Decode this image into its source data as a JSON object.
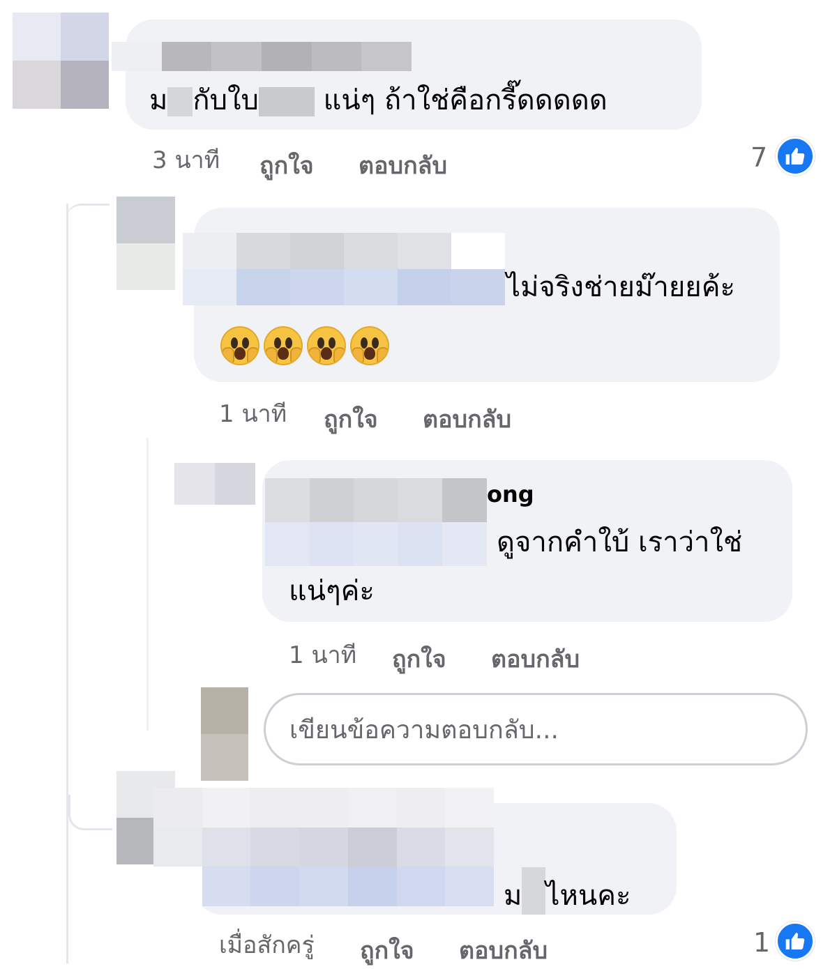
{
  "comments": [
    {
      "author": "",
      "text_pre": "ม",
      "text_mid": "กับใบ",
      "text_post": "แน่ๆ ถ้าใช่คือกรี๊ดดดดด",
      "time": "3 นาที",
      "like_label": "ถูกใจ",
      "reply_label": "ตอบกลับ",
      "reaction_count": "7"
    },
    {
      "author": "",
      "text_line1": "ไม่จริงช่ายม๊ายยค้ะ",
      "emoji_count": 4,
      "time": "1 นาที",
      "like_label": "ถูกใจ",
      "reply_label": "ตอบกลับ"
    },
    {
      "author": "ong",
      "text_line1": "ดูจากคำใบ้ เราว่าใช่",
      "text_line2": "แน่ๆค่ะ",
      "time": "1 นาที",
      "like_label": "ถูกใจ",
      "reply_label": "ตอบกลับ"
    },
    {
      "author": "",
      "text_pre": "ม",
      "text_post": "ไหนคะ",
      "time": "เมื่อสักครู่",
      "like_label": "ถูกใจ",
      "reply_label": "ตอบกลับ",
      "reaction_count": "1"
    }
  ],
  "reply_box": {
    "placeholder": "เขียนข้อความตอบกลับ..."
  },
  "icons": {
    "like": "thumbs-up-icon",
    "emoji": "face-screaming-in-fear-emoji"
  },
  "colors": {
    "like_blue": "#1877f2",
    "bubble": "#f0f2f5",
    "meta": "#65676b"
  }
}
